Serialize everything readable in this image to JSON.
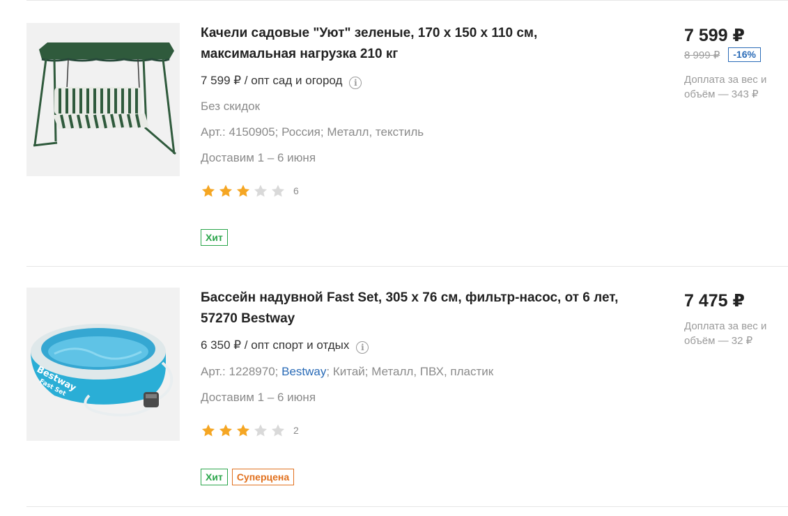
{
  "products": [
    {
      "title": "Качели садовые \"Уют\" зеленые, 170 х 150 х 110 см, максимальная нагрузка 210 кг",
      "wholesale": "7 599 ₽ / опт сад и огород",
      "discount_note": "Без скидок",
      "sku_prefix": "Арт.: 4150905; ",
      "sku_rest": "Россия; Металл, текстиль",
      "delivery": "Доставим 1 – 6 июня",
      "rating": 3,
      "rating_max": 5,
      "rating_count": "6",
      "badges": [
        "Хит"
      ],
      "price": "7 599 ₽",
      "old_price": "8 999 ₽",
      "discount": "-16%",
      "surcharge": "Доплата за вес и объём — 343 ₽",
      "image_icon": "garden-swing"
    },
    {
      "title": "Бассейн надувной Fast Set, 305 х 76 см, фильтр-насос, от 6 лет, 57270 Bestway",
      "wholesale": "6 350 ₽ / опт спорт и отдых",
      "sku_prefix": "Арт.: 1228970; ",
      "sku_brand": "Bestway",
      "sku_rest": "; Китай; Металл, ПВХ, пластик",
      "delivery": "Доставим 1 – 6 июня",
      "rating": 3,
      "rating_max": 5,
      "rating_count": "2",
      "badges": [
        "Хит",
        "Суперцена"
      ],
      "price": "7 475 ₽",
      "surcharge": "Доплата за вес и объём — 32 ₽",
      "image_icon": "inflatable-pool",
      "image_text_top": "Bestway",
      "image_text_bottom": "Fast Set"
    }
  ],
  "info_icon": "i",
  "colors": {
    "star_active": "#f5a623",
    "star_inactive": "#d9d9d9",
    "hit_badge": "#2aa54a",
    "super_badge": "#e1701d",
    "discount": "#2a6bb7",
    "link": "#2a6bb7"
  }
}
